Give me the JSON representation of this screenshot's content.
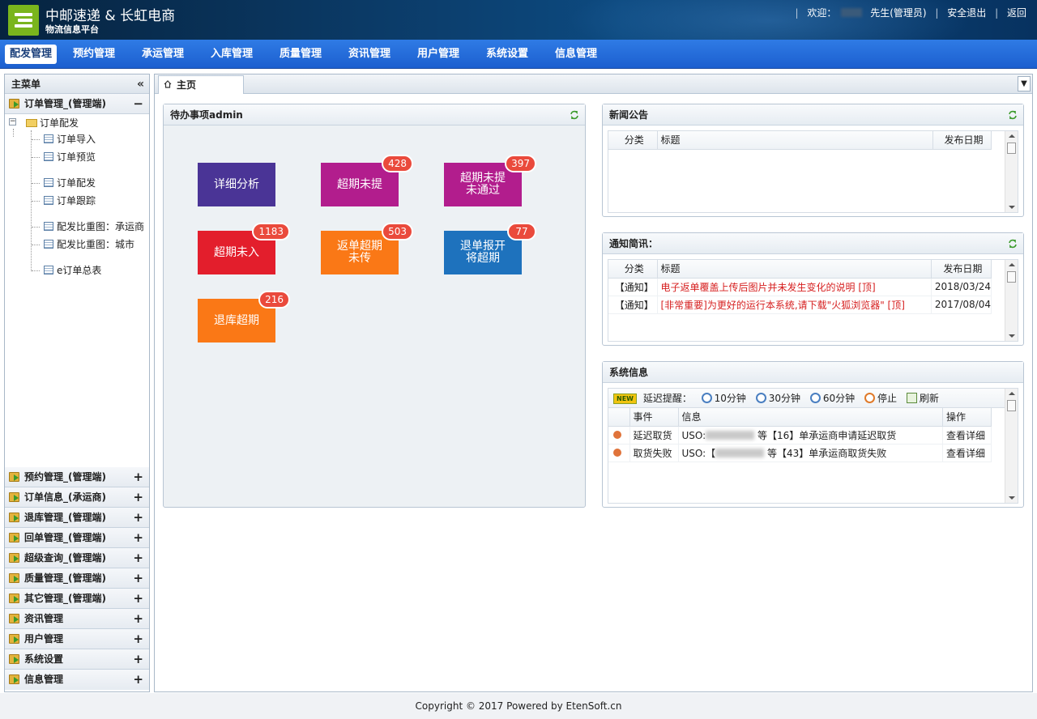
{
  "header": {
    "brand_title": "中邮速递 & 长虹电商",
    "brand_subtitle": "物流信息平台",
    "welcome": "欢迎：",
    "user_suffix": "先生(管理员)",
    "logout": "安全退出",
    "back": "返回"
  },
  "nav": {
    "items": [
      "配发管理",
      "预约管理",
      "承运管理",
      "入库管理",
      "质量管理",
      "资讯管理",
      "用户管理",
      "系统设置",
      "信息管理"
    ]
  },
  "sidebar": {
    "title": "主菜单",
    "collapse_icon": "«",
    "active_group": "订单管理_(管理端)",
    "tree": {
      "folder": "订单配发",
      "items": [
        "订单导入",
        "订单预览",
        "订单配发",
        "订单跟踪",
        "配发比重图：承运商",
        "配发比重图：城市",
        "e订单总表"
      ]
    },
    "groups": [
      "预约管理_(管理端)",
      "订单信息_(承运商)",
      "退库管理_(管理端)",
      "回单管理_(管理端)",
      "超级查询_(管理端)",
      "质量管理_(管理端)",
      "其它管理_(管理端)",
      "资讯管理",
      "用户管理",
      "系统设置",
      "信息管理"
    ]
  },
  "tabs": {
    "home": "主页"
  },
  "todo": {
    "title": "待办事项admin",
    "tiles": [
      {
        "label": "详细分析",
        "badge": "",
        "color": "#4a3496"
      },
      {
        "label": "超期未提",
        "badge": "428",
        "color": "#b21d8d"
      },
      {
        "label": "超期未提\n未通过",
        "badge": "397",
        "color": "#b21d8d"
      },
      {
        "label": "超期未入",
        "badge": "1183",
        "color": "#e31e2c"
      },
      {
        "label": "返单超期\n未传",
        "badge": "503",
        "color": "#fa7816"
      },
      {
        "label": "退单报开\n将超期",
        "badge": "77",
        "color": "#1e72bd"
      },
      {
        "label": "退库超期",
        "badge": "216",
        "color": "#fa7816"
      }
    ]
  },
  "news": {
    "title": "新闻公告",
    "columns": [
      "分类",
      "标题",
      "发布日期"
    ]
  },
  "notice": {
    "title": "通知简讯：",
    "columns": [
      "分类",
      "标题",
      "发布日期"
    ],
    "rows": [
      {
        "cat": "【通知】",
        "title": "电子返单覆盖上传后图片并未发生变化的说明 [顶]",
        "date": "2018/03/24"
      },
      {
        "cat": "【通知】",
        "title": "[非常重要]为更好的运行本系统,请下载\"火狐浏览器\" [顶]",
        "date": "2017/08/04"
      }
    ]
  },
  "sysinfo": {
    "title": "系统信息",
    "new_tag": "NEW",
    "delay_label": "延迟提醒：",
    "options": [
      "10分钟",
      "30分钟",
      "60分钟",
      "停止",
      "刷新"
    ],
    "columns": [
      "事件",
      "信息",
      "操作"
    ],
    "rows": [
      {
        "event": "延迟取货",
        "prefix": "USO:",
        "mid": "等【16】单承运商申请延迟取货",
        "action": "查看详细"
      },
      {
        "event": "取货失败",
        "prefix": "USO:【",
        "mid": "等【43】单承运商取货失败",
        "action": "查看详细"
      }
    ]
  },
  "footer": {
    "copyright": "Copyright © 2017 Powered by EtenSoft.cn"
  }
}
